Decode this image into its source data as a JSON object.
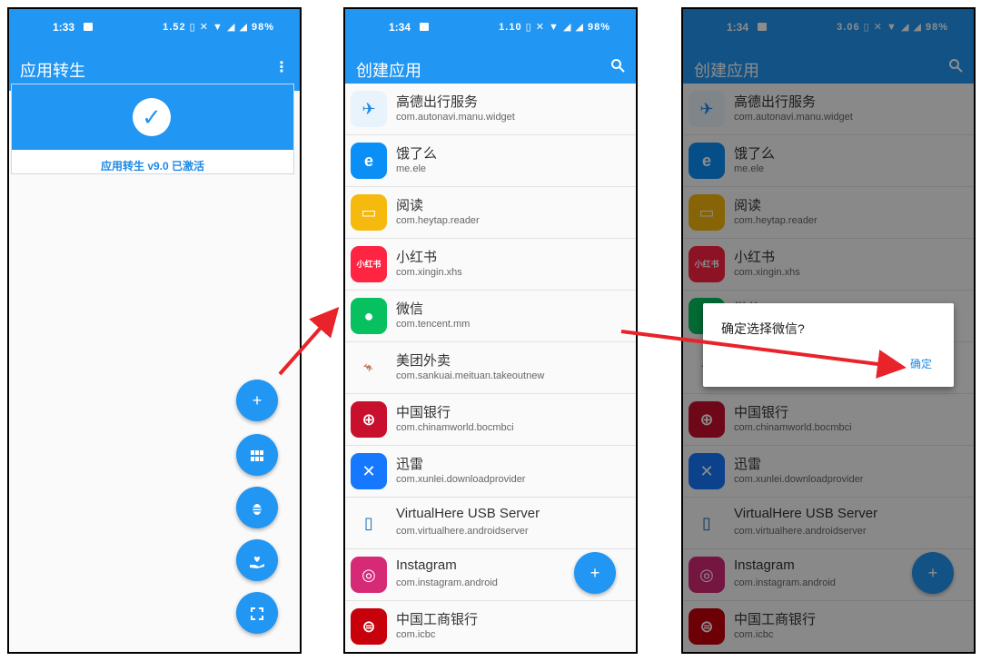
{
  "panel1": {
    "status": {
      "time": "1:33",
      "icons": "1.52 ▯ ✕ ▼ ◢ ◢ 98%"
    },
    "appbar": {
      "title": "应用转生",
      "menu": "⋮"
    },
    "activation": {
      "label": "应用转生 v9.0 已激活"
    },
    "fabs": [
      "add-icon",
      "apps-grid-icon",
      "bug-icon",
      "heart-hand-icon",
      "fullscreen-icon"
    ]
  },
  "panel2": {
    "status": {
      "time": "1:34",
      "icons": "1.10 ▯ ✕ ▼ ◢ ◢ 98%"
    },
    "appbar": {
      "title": "创建应用",
      "search": "🔍"
    }
  },
  "panel3": {
    "status": {
      "time": "1:34",
      "icons": "3.06 ▯ ✕ ▼ ◢ ◢ 98%"
    },
    "appbar": {
      "title": "创建应用",
      "search": "🔍"
    },
    "dialog": {
      "message": "确定选择微信?",
      "confirm": "确定"
    }
  },
  "apps": [
    {
      "name": "高德出行服务",
      "pkg": "com.autonavi.manu.widget",
      "color": "#e9f3fb",
      "glyph": "✈",
      "fg": "#1e88e5"
    },
    {
      "name": "饿了么",
      "pkg": "me.ele",
      "color": "#0a8ff6",
      "glyph": "e",
      "fg": "#ffffff"
    },
    {
      "name": "阅读",
      "pkg": "com.heytap.reader",
      "color": "#f6b90d",
      "glyph": "▭",
      "fg": "#ffffff"
    },
    {
      "name": "小红书",
      "pkg": "com.xingin.xhs",
      "color": "#ff2442",
      "glyph": "小红书",
      "fg": "#ffffff"
    },
    {
      "name": "微信",
      "pkg": "com.tencent.mm",
      "color": "#07c160",
      "glyph": "●",
      "fg": "#ffffff"
    },
    {
      "name": "美团外卖",
      "pkg": "com.sankuai.meituan.takeoutnew",
      "color": "#fafafa",
      "glyph": "🦘",
      "fg": "#f5a623"
    },
    {
      "name": "中国银行",
      "pkg": "com.chinamworld.bocmbci",
      "color": "#c8102e",
      "glyph": "⊕",
      "fg": "#ffffff"
    },
    {
      "name": "迅雷",
      "pkg": "com.xunlei.downloadprovider",
      "color": "#1677ff",
      "glyph": "✕",
      "fg": "#ffffff"
    },
    {
      "name": "VirtualHere USB Server",
      "pkg": "com.virtualhere.androidserver",
      "color": "#fafafa",
      "glyph": "▯",
      "fg": "#1c6fb5"
    },
    {
      "name": "Instagram",
      "pkg": "com.instagram.android",
      "color": "#d62976",
      "glyph": "◎",
      "fg": "#ffffff"
    },
    {
      "name": "中国工商银行",
      "pkg": "com.icbc",
      "color": "#c7000b",
      "glyph": "⊜",
      "fg": "#ffffff"
    }
  ],
  "fab_add": "+"
}
